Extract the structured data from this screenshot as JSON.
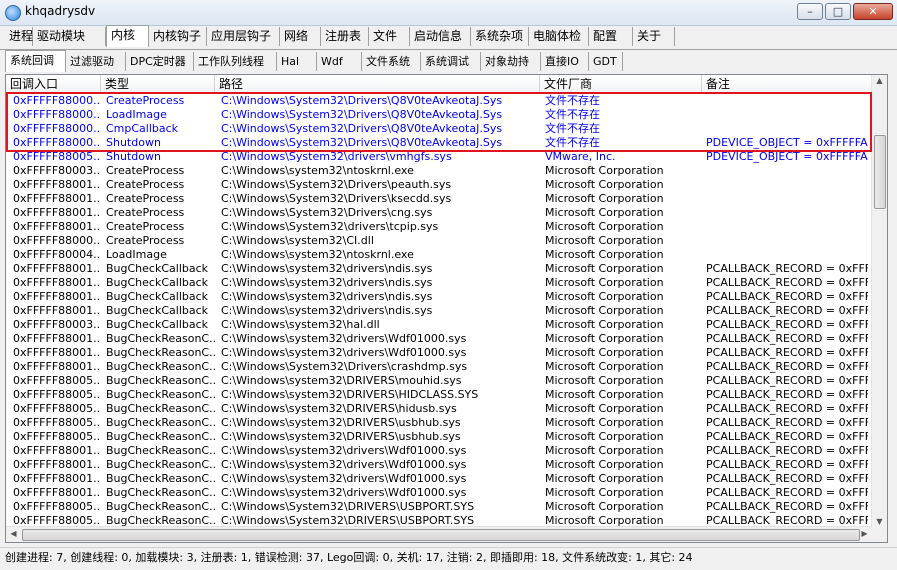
{
  "window": {
    "title": "khqadrysdv"
  },
  "menu_tabs": [
    "进程",
    "驱动模块",
    "内核",
    "内核钩子",
    "应用层钩子",
    "网络",
    "注册表",
    "文件",
    "启动信息",
    "系统杂项",
    "电脑体检",
    "配置",
    "关于"
  ],
  "sub_tabs": [
    "系统回调",
    "过滤驱动",
    "DPC定时器",
    "工作队列线程",
    "Hal",
    "Wdf",
    "文件系统",
    "系统调试",
    "对象劫持",
    "直接IO",
    "GDT"
  ],
  "columns": [
    "回调入口",
    "类型",
    "路径",
    "文件厂商",
    "备注"
  ],
  "rows": [
    [
      "0xFFFFF88000...",
      "CreateProcess",
      "C:\\Windows\\System32\\Drivers\\Q8V0teAvkeotaJ.Sys",
      "文件不存在",
      ""
    ],
    [
      "0xFFFFF88000...",
      "LoadImage",
      "C:\\Windows\\System32\\Drivers\\Q8V0teAvkeotaJ.Sys",
      "文件不存在",
      ""
    ],
    [
      "0xFFFFF88000...",
      "CmpCallback",
      "C:\\Windows\\System32\\Drivers\\Q8V0teAvkeotaJ.Sys",
      "文件不存在",
      ""
    ],
    [
      "0xFFFFF88000...",
      "Shutdown",
      "C:\\Windows\\System32\\Drivers\\Q8V0teAvkeotaJ.Sys",
      "文件不存在",
      "PDEVICE_OBJECT = 0xFFFFFA8..."
    ],
    [
      "0xFFFFF88005...",
      "Shutdown",
      "C:\\Windows\\System32\\drivers\\vmhgfs.sys",
      "VMware, Inc.",
      "PDEVICE_OBJECT = 0xFFFFFA8..."
    ],
    [
      "0xFFFFF80003...",
      "CreateProcess",
      "C:\\Windows\\system32\\ntoskrnl.exe",
      "Microsoft Corporation",
      ""
    ],
    [
      "0xFFFFF88001...",
      "CreateProcess",
      "C:\\Windows\\System32\\Drivers\\peauth.sys",
      "Microsoft Corporation",
      ""
    ],
    [
      "0xFFFFF88001...",
      "CreateProcess",
      "C:\\Windows\\System32\\Drivers\\ksecdd.sys",
      "Microsoft Corporation",
      ""
    ],
    [
      "0xFFFFF88001...",
      "CreateProcess",
      "C:\\Windows\\System32\\Drivers\\cng.sys",
      "Microsoft Corporation",
      ""
    ],
    [
      "0xFFFFF88001...",
      "CreateProcess",
      "C:\\Windows\\System32\\drivers\\tcpip.sys",
      "Microsoft Corporation",
      ""
    ],
    [
      "0xFFFFF88000...",
      "CreateProcess",
      "C:\\Windows\\system32\\CI.dll",
      "Microsoft Corporation",
      ""
    ],
    [
      "0xFFFFF80004...",
      "LoadImage",
      "C:\\Windows\\system32\\ntoskrnl.exe",
      "Microsoft Corporation",
      ""
    ],
    [
      "0xFFFFF88001...",
      "BugCheckCallback",
      "C:\\Windows\\system32\\drivers\\ndis.sys",
      "Microsoft Corporation",
      "PCALLBACK_RECORD = 0xFFFFF..."
    ],
    [
      "0xFFFFF88001...",
      "BugCheckCallback",
      "C:\\Windows\\system32\\drivers\\ndis.sys",
      "Microsoft Corporation",
      "PCALLBACK_RECORD = 0xFFFFF..."
    ],
    [
      "0xFFFFF88001...",
      "BugCheckCallback",
      "C:\\Windows\\system32\\drivers\\ndis.sys",
      "Microsoft Corporation",
      "PCALLBACK_RECORD = 0xFFFFF..."
    ],
    [
      "0xFFFFF88001...",
      "BugCheckCallback",
      "C:\\Windows\\system32\\drivers\\ndis.sys",
      "Microsoft Corporation",
      "PCALLBACK_RECORD = 0xFFFFF..."
    ],
    [
      "0xFFFFF80003...",
      "BugCheckCallback",
      "C:\\Windows\\system32\\hal.dll",
      "Microsoft Corporation",
      "PCALLBACK_RECORD = 0xFFFFF..."
    ],
    [
      "0xFFFFF88001...",
      "BugCheckReasonC...",
      "C:\\Windows\\system32\\drivers\\Wdf01000.sys",
      "Microsoft Corporation",
      "PCALLBACK_RECORD = 0xFFFFF..."
    ],
    [
      "0xFFFFF88001...",
      "BugCheckReasonC...",
      "C:\\Windows\\system32\\drivers\\Wdf01000.sys",
      "Microsoft Corporation",
      "PCALLBACK_RECORD = 0xFFFFF..."
    ],
    [
      "0xFFFFF88001...",
      "BugCheckReasonC...",
      "C:\\Windows\\System32\\Drivers\\crashdmp.sys",
      "Microsoft Corporation",
      "PCALLBACK_RECORD = 0xFFFFF..."
    ],
    [
      "0xFFFFF88005...",
      "BugCheckReasonC...",
      "C:\\Windows\\system32\\DRIVERS\\mouhid.sys",
      "Microsoft Corporation",
      "PCALLBACK_RECORD = 0xFFFFF..."
    ],
    [
      "0xFFFFF88005...",
      "BugCheckReasonC...",
      "C:\\Windows\\system32\\DRIVERS\\HIDCLASS.SYS",
      "Microsoft Corporation",
      "PCALLBACK_RECORD = 0xFFFFF..."
    ],
    [
      "0xFFFFF88005...",
      "BugCheckReasonC...",
      "C:\\Windows\\system32\\DRIVERS\\hidusb.sys",
      "Microsoft Corporation",
      "PCALLBACK_RECORD = 0xFFFFF..."
    ],
    [
      "0xFFFFF88005...",
      "BugCheckReasonC...",
      "C:\\Windows\\system32\\DRIVERS\\usbhub.sys",
      "Microsoft Corporation",
      "PCALLBACK_RECORD = 0xFFFFF..."
    ],
    [
      "0xFFFFF88005...",
      "BugCheckReasonC...",
      "C:\\Windows\\system32\\DRIVERS\\usbhub.sys",
      "Microsoft Corporation",
      "PCALLBACK_RECORD = 0xFFFFF..."
    ],
    [
      "0xFFFFF88001...",
      "BugCheckReasonC...",
      "C:\\Windows\\system32\\drivers\\Wdf01000.sys",
      "Microsoft Corporation",
      "PCALLBACK_RECORD = 0xFFFFF..."
    ],
    [
      "0xFFFFF88001...",
      "BugCheckReasonC...",
      "C:\\Windows\\system32\\drivers\\Wdf01000.sys",
      "Microsoft Corporation",
      "PCALLBACK_RECORD = 0xFFFFF..."
    ],
    [
      "0xFFFFF88001...",
      "BugCheckReasonC...",
      "C:\\Windows\\system32\\drivers\\Wdf01000.sys",
      "Microsoft Corporation",
      "PCALLBACK_RECORD = 0xFFFFF..."
    ],
    [
      "0xFFFFF88001...",
      "BugCheckReasonC...",
      "C:\\Windows\\system32\\drivers\\Wdf01000.sys",
      "Microsoft Corporation",
      "PCALLBACK_RECORD = 0xFFFFF..."
    ],
    [
      "0xFFFFF88005...",
      "BugCheckReasonC...",
      "C:\\Windows\\System32\\DRIVERS\\USBPORT.SYS",
      "Microsoft Corporation",
      "PCALLBACK_RECORD = 0xFFFFF..."
    ],
    [
      "0xFFFFF88005...",
      "BugCheckReasonC...",
      "C:\\Windows\\System32\\DRIVERS\\USBPORT.SYS",
      "Microsoft Corporation",
      "PCALLBACK_RECORD = 0xFFFFF..."
    ]
  ],
  "highlighted_row_count": 5,
  "status_text": "创建进程: 7, 创建线程: 0, 加载模块: 3, 注册表: 1, 错误检测: 37, Lego回调: 0, 关机: 17, 注销: 2, 即插即用: 18, 文件系统改变: 1, 其它: 24",
  "colors": {
    "highlight_text": "#0000ee",
    "selection_border": "#e0141e"
  }
}
